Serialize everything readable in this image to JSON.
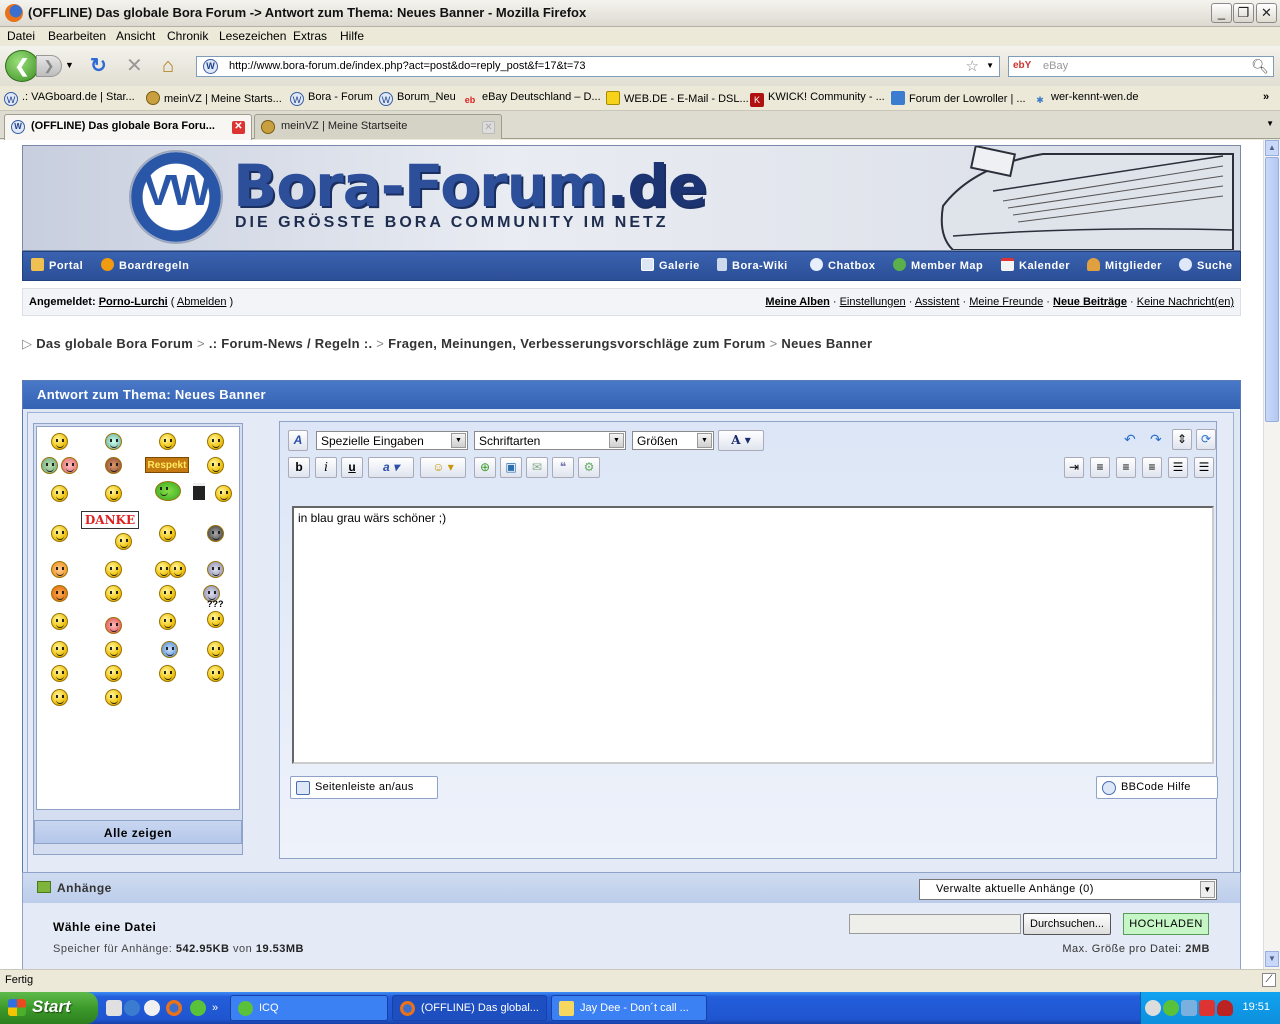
{
  "window": {
    "title": "(OFFLINE) Das globale Bora Forum -> Antwort zum Thema: Neues Banner - Mozilla Firefox"
  },
  "menu": [
    "Datei",
    "Bearbeiten",
    "Ansicht",
    "Chronik",
    "Lesezeichen",
    "Extras",
    "Hilfe"
  ],
  "nav": {
    "url": "http://www.bora-forum.de/index.php?act=post&do=reply_post&f=17&t=73",
    "search_placeholder": "eBay",
    "search_engine": "ebY"
  },
  "bookmarks": [
    ".: VAGboard.de | Star...",
    "meinVZ | Meine Starts...",
    "Bora - Forum",
    "Borum_Neu",
    "eBay Deutschland – D...",
    "WEB.DE - E-Mail - DSL...",
    "KWICK! Community - ...",
    "Forum der Lowroller | ...",
    "wer-kennt-wen.de"
  ],
  "tabs": [
    {
      "label": "(OFFLINE) Das globale Bora Foru...",
      "active": true
    },
    {
      "label": "meinVZ | Meine Startseite",
      "active": false
    }
  ],
  "banner": {
    "logo_text": "VW",
    "title_main": "Bora-Forum",
    "title_suffix": ".de",
    "subtitle": "DIE GRÖSSTE BORA COMMUNITY IM NETZ"
  },
  "forum_nav": {
    "left": [
      "Portal",
      "Boardregeln"
    ],
    "right": [
      "Galerie",
      "Bora-Wiki",
      "Chatbox",
      "Member Map",
      "Kalender",
      "Mitglieder",
      "Suche"
    ]
  },
  "userbar": {
    "prefix": "Angemeldet:",
    "username": "Porno-Lurchi",
    "logout": "Abmelden",
    "links": [
      "Meine Alben",
      "Einstellungen",
      "Assistent",
      "Meine Freunde",
      "Neue Beiträge",
      "Keine Nachricht(en)"
    ]
  },
  "breadcrumb": [
    "Das globale Bora Forum",
    ".: Forum-News / Regeln :.",
    "Fragen, Meinungen, Verbesserungsvorschläge zum Forum",
    "Neues Banner"
  ],
  "reply": {
    "header": "Antwort zum Thema: Neues Banner",
    "toolbar": {
      "special": "Spezielle Eingaben",
      "fonts": "Schriftarten",
      "sizes": "Größen"
    },
    "text": "in blau grau wärs schöner ;)",
    "sidebar_toggle": "Seitenleiste an/aus",
    "bbcode_help": "BBCode Hilfe",
    "show_all": "Alle zeigen",
    "smiley_labels": {
      "respekt": "Respekt",
      "danke": "DANKE",
      "question": "???"
    }
  },
  "attachments": {
    "title": "Anhänge",
    "manage": "Verwalte aktuelle Anhänge (0)",
    "choose": "Wähle eine Datei",
    "browse": "Durchsuchen...",
    "upload": "HOCHLADEN",
    "storage_prefix": "Speicher für Anhänge:",
    "used": "542.95KB",
    "of": "von",
    "total": "19.53MB",
    "maxsize_label": "Max. Größe pro Datei:",
    "maxsize": "2MB"
  },
  "status": "Fertig",
  "taskbar": {
    "start": "Start",
    "tasks": [
      "ICQ",
      "(OFFLINE) Das global...",
      "Jay Dee - Don´t call ..."
    ],
    "clock": "19:51"
  }
}
